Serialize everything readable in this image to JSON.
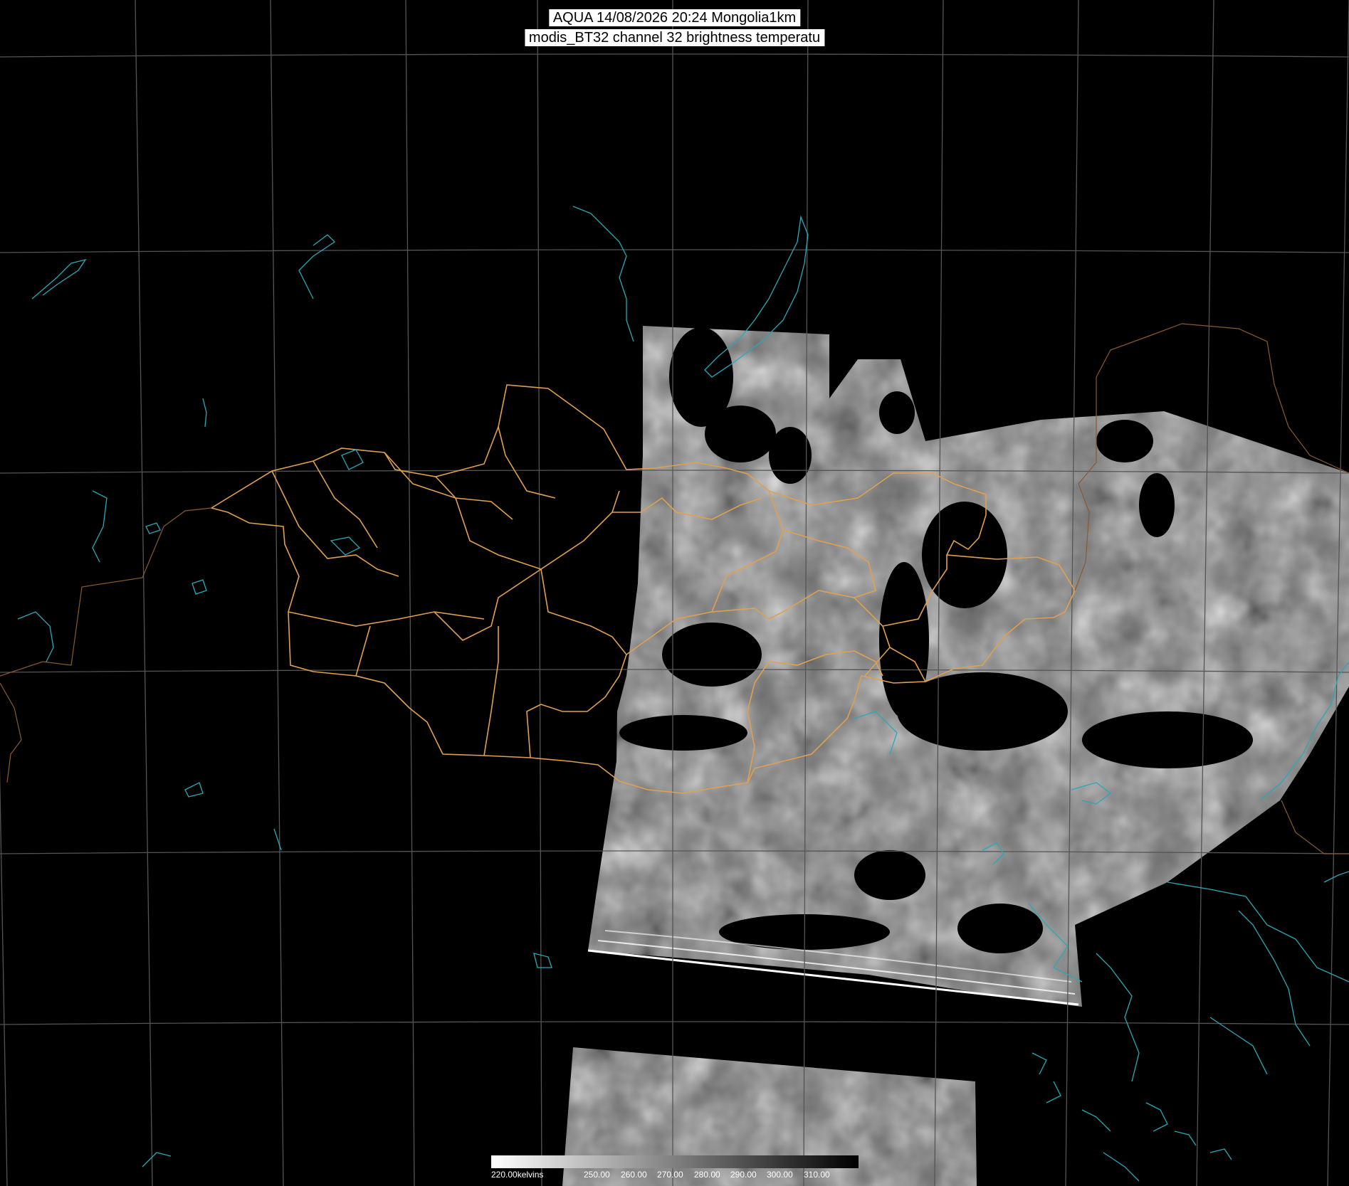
{
  "title": {
    "line1": "AQUA 14/08/2026 20:24 Mongolia1km",
    "line2": "modis_BT32 channel 32 brightness temperatu"
  },
  "colorbar": {
    "min_label": "220.00kelvins",
    "tick_labels": [
      "250.00",
      "260.00",
      "270.00",
      "280.00",
      "290.00",
      "300.00",
      "310.00"
    ],
    "range_kelvin": [
      220,
      320
    ],
    "ramp": [
      "#ffffff",
      "#000000"
    ]
  },
  "colors": {
    "background": "#000000",
    "graticule": "#555555",
    "admin_borders": "#e0a050",
    "coastlines_rivers": "#2aa8b8"
  }
}
